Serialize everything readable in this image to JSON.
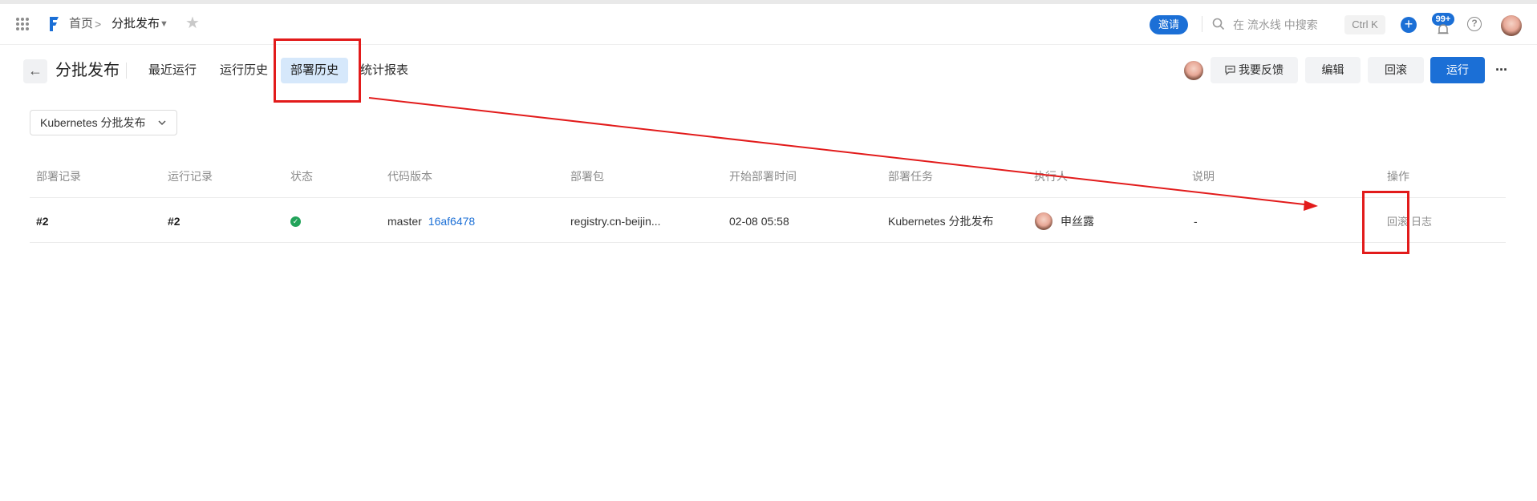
{
  "topbar": {
    "breadcrumb_home": "首页",
    "breadcrumb_sep": ">",
    "breadcrumb_current": "分批发布",
    "invite_label": "邀请",
    "search_placeholder": "在 流水线 中搜索",
    "shortcut": "Ctrl K",
    "notification_badge": "99+",
    "help": "?",
    "plus": "+"
  },
  "header": {
    "back": "←",
    "title": "分批发布",
    "tabs": [
      {
        "label": "最近运行",
        "active": false
      },
      {
        "label": "运行历史",
        "active": false
      },
      {
        "label": "部署历史",
        "active": true
      },
      {
        "label": "统计报表",
        "active": false
      }
    ],
    "feedback_label": "我要反馈",
    "edit_label": "编辑",
    "rollback_label": "回滚",
    "run_label": "运行",
    "more_label": "···"
  },
  "filter": {
    "selected": "Kubernetes 分批发布"
  },
  "table": {
    "headers": [
      "部署记录",
      "运行记录",
      "状态",
      "代码版本",
      "部署包",
      "开始部署时间",
      "部署任务",
      "执行人",
      "说明",
      "操作"
    ],
    "rows": [
      {
        "deploy_record": "#2",
        "run_record": "#2",
        "status": "success",
        "branch": "master",
        "commit": "16af6478",
        "package": "registry.cn-beijin...",
        "start_time": "02-08 05:58",
        "task": "Kubernetes 分批发布",
        "executor": "申丝露",
        "description": "-",
        "actions": [
          "回滚",
          "日志"
        ]
      }
    ]
  },
  "colors": {
    "primary": "#1b6fd6",
    "active_tab_bg": "#d6e8fb",
    "success": "#22a35a",
    "annotation": "#e21b1b"
  },
  "icons": [
    "apps-grid-icon",
    "logo-icon",
    "star-icon",
    "search-icon",
    "plus-icon",
    "bell-icon",
    "help-icon",
    "chat-icon",
    "chevron-down-icon",
    "check-circle-icon"
  ]
}
